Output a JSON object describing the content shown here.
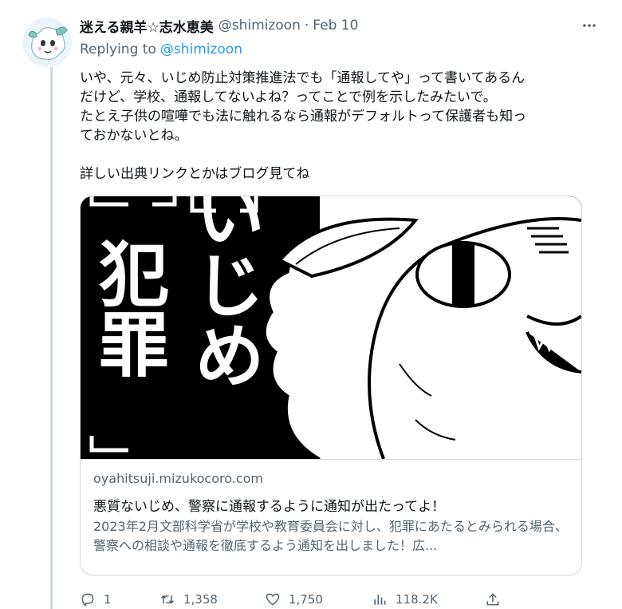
{
  "tweet": {
    "display_name": "迷える親羊☆志水恵美",
    "handle": "@shimizoon",
    "separator": "·",
    "date": "Feb 10",
    "replying_prefix": "Replying to",
    "replying_to": "@shimizoon",
    "text_lines": [
      "いや、元々、いじめ防止対策推進法でも「通報してや」って書いてあるん",
      "だけど、学校、通報してないよね？ってことで例を示したみたいで。",
      "たとえ子供の喧嘩でも法に触れるなら通報がデフォルトって保護者も知っ",
      "ておかないとね。",
      "",
      "詳しい出典リンクとかはブログ見てね"
    ]
  },
  "card": {
    "image_text_left": "犯罪",
    "image_text_right": "いじめ",
    "domain": "oyahitsuji.mizukocoro.com",
    "title": "悪質ないじめ、警察に通報するように通知が出たってよ！",
    "description": "2023年2月文部科学省が学校や教育委員会に対し、犯罪にあたるとみられる場合、警察への相談や通報を徹底するよう通知を出しました！広..."
  },
  "actions": {
    "reply_count": "1",
    "retweet_count": "1,358",
    "like_count": "1,750",
    "view_count": "118.2K"
  },
  "icons": {
    "more": "more-icon",
    "reply": "reply-icon",
    "retweet": "retweet-icon",
    "like": "heart-icon",
    "views": "views-icon",
    "share": "share-icon"
  },
  "colors": {
    "link": "#1d9bf0",
    "secondary_text": "#536471",
    "border": "#cfd9de"
  }
}
